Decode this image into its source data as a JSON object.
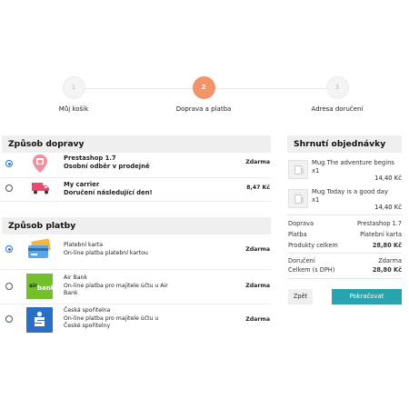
{
  "steps": [
    {
      "number": "1",
      "label": "Můj košík"
    },
    {
      "number": "2",
      "label": "Doprava a platba"
    },
    {
      "number": "3",
      "label": "Adresa doručení"
    }
  ],
  "shipping": {
    "title": "Způsob dopravy",
    "options": [
      {
        "name": "Prestashop 1.7",
        "desc": "Osobní odběr v prodejně",
        "price": "Zdarma",
        "icon": "map-pin-icon"
      },
      {
        "name": "My carrier",
        "desc": "Doručení následující den!",
        "price": "8,47 Kč",
        "icon": "truck-icon"
      }
    ]
  },
  "payment": {
    "title": "Způsob platby",
    "options": [
      {
        "name": "Platební karta",
        "desc1": "On-line platba platební kartou",
        "desc2": "",
        "desc3": "",
        "price": "Zdarma",
        "icon": "credit-card-icon"
      },
      {
        "name": "Air Bank",
        "desc1": "On-line platba pro majitele účtu u Air",
        "desc2": "Bank",
        "desc3": "",
        "price": "Zdarma",
        "icon": "air-bank-logo",
        "logo_text_left": "air",
        "logo_text_right": "bank"
      },
      {
        "name": "Česká spořitelna",
        "desc1": "On-line platba pro majitele účtu u",
        "desc2": "České spořitelny",
        "desc3": "",
        "price": "Zdarma",
        "icon": "ceska-sporitelna-logo"
      }
    ]
  },
  "summary": {
    "title": "Shrnutí objednávky",
    "items": [
      {
        "name": "Mug The adventure begins",
        "qty": "x1",
        "price": "14,40 Kč"
      },
      {
        "name": "Mug Today is a good day",
        "qty": "x1",
        "price": "14,40 Kč"
      }
    ],
    "lines": [
      {
        "label": "Doprava",
        "value": "Prestashop 1.7"
      },
      {
        "label": "Platba",
        "value": "Platební karta"
      },
      {
        "label": "Produkty celkem",
        "value": "28,80 Kč"
      },
      {
        "label": "Doručení",
        "value": "Zdarma"
      },
      {
        "label": "Celkem (s DPH)",
        "value": "28,80 Kč"
      }
    ],
    "back_label": "Zpět",
    "continue_label": "Pokračovat"
  },
  "colors": {
    "accent_step": "#f0956a",
    "continue_button": "#2aa3b1",
    "radio_selected": "#1f7bd8"
  }
}
